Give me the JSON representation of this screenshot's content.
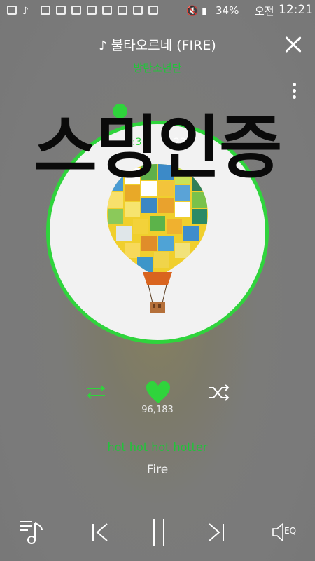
{
  "status_bar": {
    "battery": "34%",
    "ampm": "오전",
    "clock": "12:21",
    "icons": [
      "message-icon",
      "music-app-icon",
      "image-icon",
      "app-icon",
      "app-icon",
      "app-icon",
      "app-icon",
      "app-icon",
      "app-icon",
      "app-icon",
      "mute-icon",
      "wifi-icon",
      "signal-icon"
    ]
  },
  "header": {
    "song_title": "불타오르네 (FIRE)",
    "artist": "방탄소년단"
  },
  "player": {
    "time_elapsed": "3:3",
    "time_separator": "·",
    "time_total": "23",
    "progress_fraction": 0.0,
    "overlay_text": "스밍인증",
    "like_count": "96,183",
    "lyric_current": "hot hot hot hotter",
    "lyric_next": "Fire",
    "eq_label": "EQ"
  },
  "colors": {
    "accent": "#2fd43c",
    "background": "#7a7a7a"
  }
}
